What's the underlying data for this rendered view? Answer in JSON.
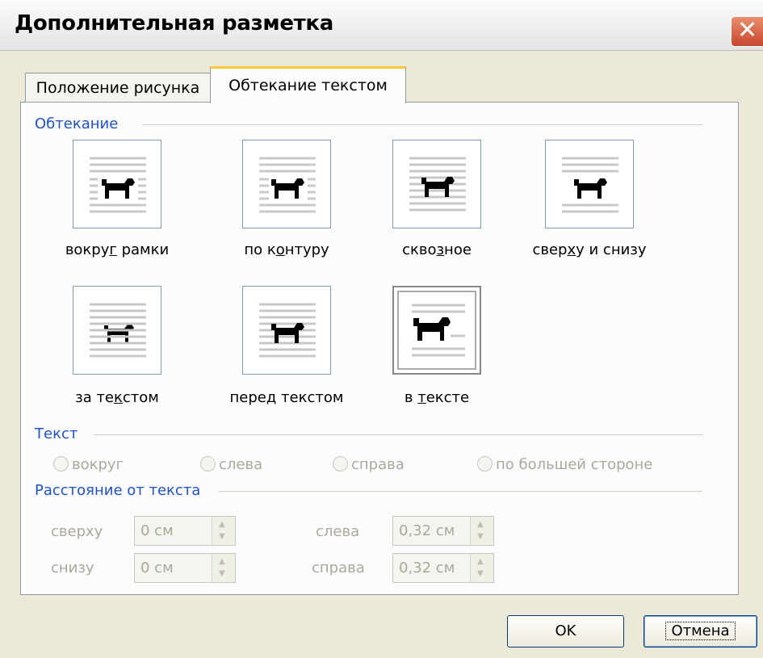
{
  "window": {
    "title": "Дополнительная разметка"
  },
  "tabs": [
    {
      "label": "Положение рисунка",
      "active": false
    },
    {
      "label": "Обтекание текстом",
      "active": true
    }
  ],
  "wrapping": {
    "group_label": "Обтекание",
    "options": [
      {
        "pre": "вокру",
        "ul": "г",
        "post": " рамки",
        "icon": "square-wrap-icon"
      },
      {
        "pre": "по к",
        "ul": "о",
        "post": "нтуру",
        "icon": "tight-wrap-icon"
      },
      {
        "pre": "скво",
        "ul": "з",
        "post": "ное",
        "icon": "through-wrap-icon"
      },
      {
        "pre": "свер",
        "ul": "х",
        "post": "у и снизу",
        "icon": "top-bottom-wrap-icon"
      },
      {
        "pre": "за те",
        "ul": "к",
        "post": "стом",
        "icon": "behind-text-icon"
      },
      {
        "pre": "пере",
        "ul": "д",
        "post": " текстом",
        "icon": "in-front-of-text-icon"
      },
      {
        "pre": "в ",
        "ul": "т",
        "post": "ексте",
        "icon": "in-line-icon",
        "selected": true
      }
    ]
  },
  "text_side": {
    "group_label": "Текст",
    "options": [
      "вокруг",
      "слева",
      "справа",
      "по большей стороне"
    ]
  },
  "distance": {
    "group_label": "Расстояние от текста",
    "top": {
      "label": "сверху",
      "value": "0 см"
    },
    "bottom": {
      "label": "снизу",
      "value": "0 см"
    },
    "left": {
      "label": "слева",
      "value": "0,32 см"
    },
    "right": {
      "label": "справа",
      "value": "0,32 см"
    }
  },
  "buttons": {
    "ok": "OK",
    "cancel": "Отмена"
  },
  "colors": {
    "group_label": "#1f52c2",
    "disabled_text": "#aca899",
    "tab_highlight": "#ffc83c"
  }
}
